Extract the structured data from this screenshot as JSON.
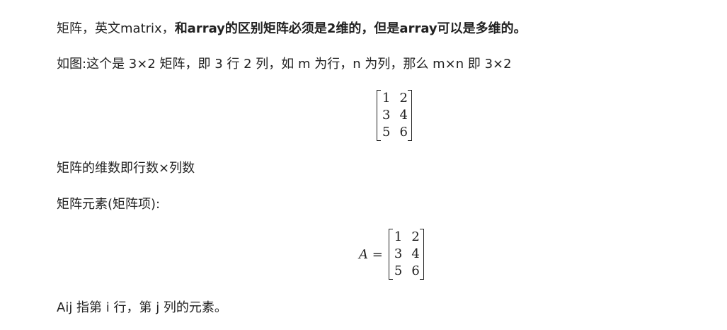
{
  "paragraphs": {
    "p1_normal": "矩阵，英文matrix，",
    "p1_bold": "和array的区别矩阵必须是2维的，但是array可以是多维的。",
    "p2": "如图:这个是 3×2 矩阵，即 3 行 2 列，如 m 为行，n 为列，那么 m×n 即 3×2",
    "p3": "矩阵的维数即行数×列数",
    "p4": "矩阵元素(矩阵项):",
    "p5": "Aij 指第 i 行，第 j 列的元素。"
  },
  "matrix1": {
    "rows": [
      [
        "1",
        "2"
      ],
      [
        "3",
        "4"
      ],
      [
        "5",
        "6"
      ]
    ]
  },
  "matrix2": {
    "lhs_var": "A",
    "equals": "=",
    "rows": [
      [
        "1",
        "2"
      ],
      [
        "3",
        "4"
      ],
      [
        "5",
        "6"
      ]
    ]
  }
}
